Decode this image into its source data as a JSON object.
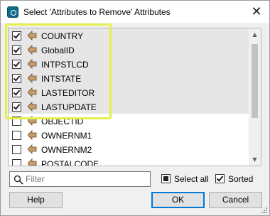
{
  "window": {
    "title": "Select 'Attributes to Remove' Attributes",
    "close_symbol": "✕"
  },
  "attributes": [
    {
      "name": "COUNTRY",
      "checked": true,
      "selected": true
    },
    {
      "name": "GlobalID",
      "checked": true,
      "selected": true
    },
    {
      "name": "INTPSTLCD",
      "checked": true,
      "selected": true
    },
    {
      "name": "INTSTATE",
      "checked": true,
      "selected": true
    },
    {
      "name": "LASTEDITOR",
      "checked": true,
      "selected": true
    },
    {
      "name": "LASTUPDATE",
      "checked": true,
      "selected": true
    },
    {
      "name": "OBJECTID",
      "checked": false,
      "selected": false
    },
    {
      "name": "OWNERNM1",
      "checked": false,
      "selected": false
    },
    {
      "name": "OWNERNM2",
      "checked": false,
      "selected": false
    },
    {
      "name": "POSTALCODE",
      "checked": false,
      "selected": false
    }
  ],
  "filter": {
    "placeholder": "Filter",
    "value": ""
  },
  "options": {
    "select_all_label": "Select all",
    "select_all_state": "indeterminate",
    "sorted_label": "Sorted",
    "sorted_checked": true
  },
  "buttons": {
    "help": "Help",
    "ok": "OK",
    "cancel": "Cancel"
  },
  "colors": {
    "highlight": "#e6f04a",
    "selected_row": "#e6e6e6",
    "attribute_icon": "#c89b6a",
    "primary_border": "#0078d7"
  },
  "icons": {
    "app": "fme-app-icon",
    "attribute": "attribute-arrow-icon",
    "filter": "search-icon",
    "close": "close-icon"
  }
}
